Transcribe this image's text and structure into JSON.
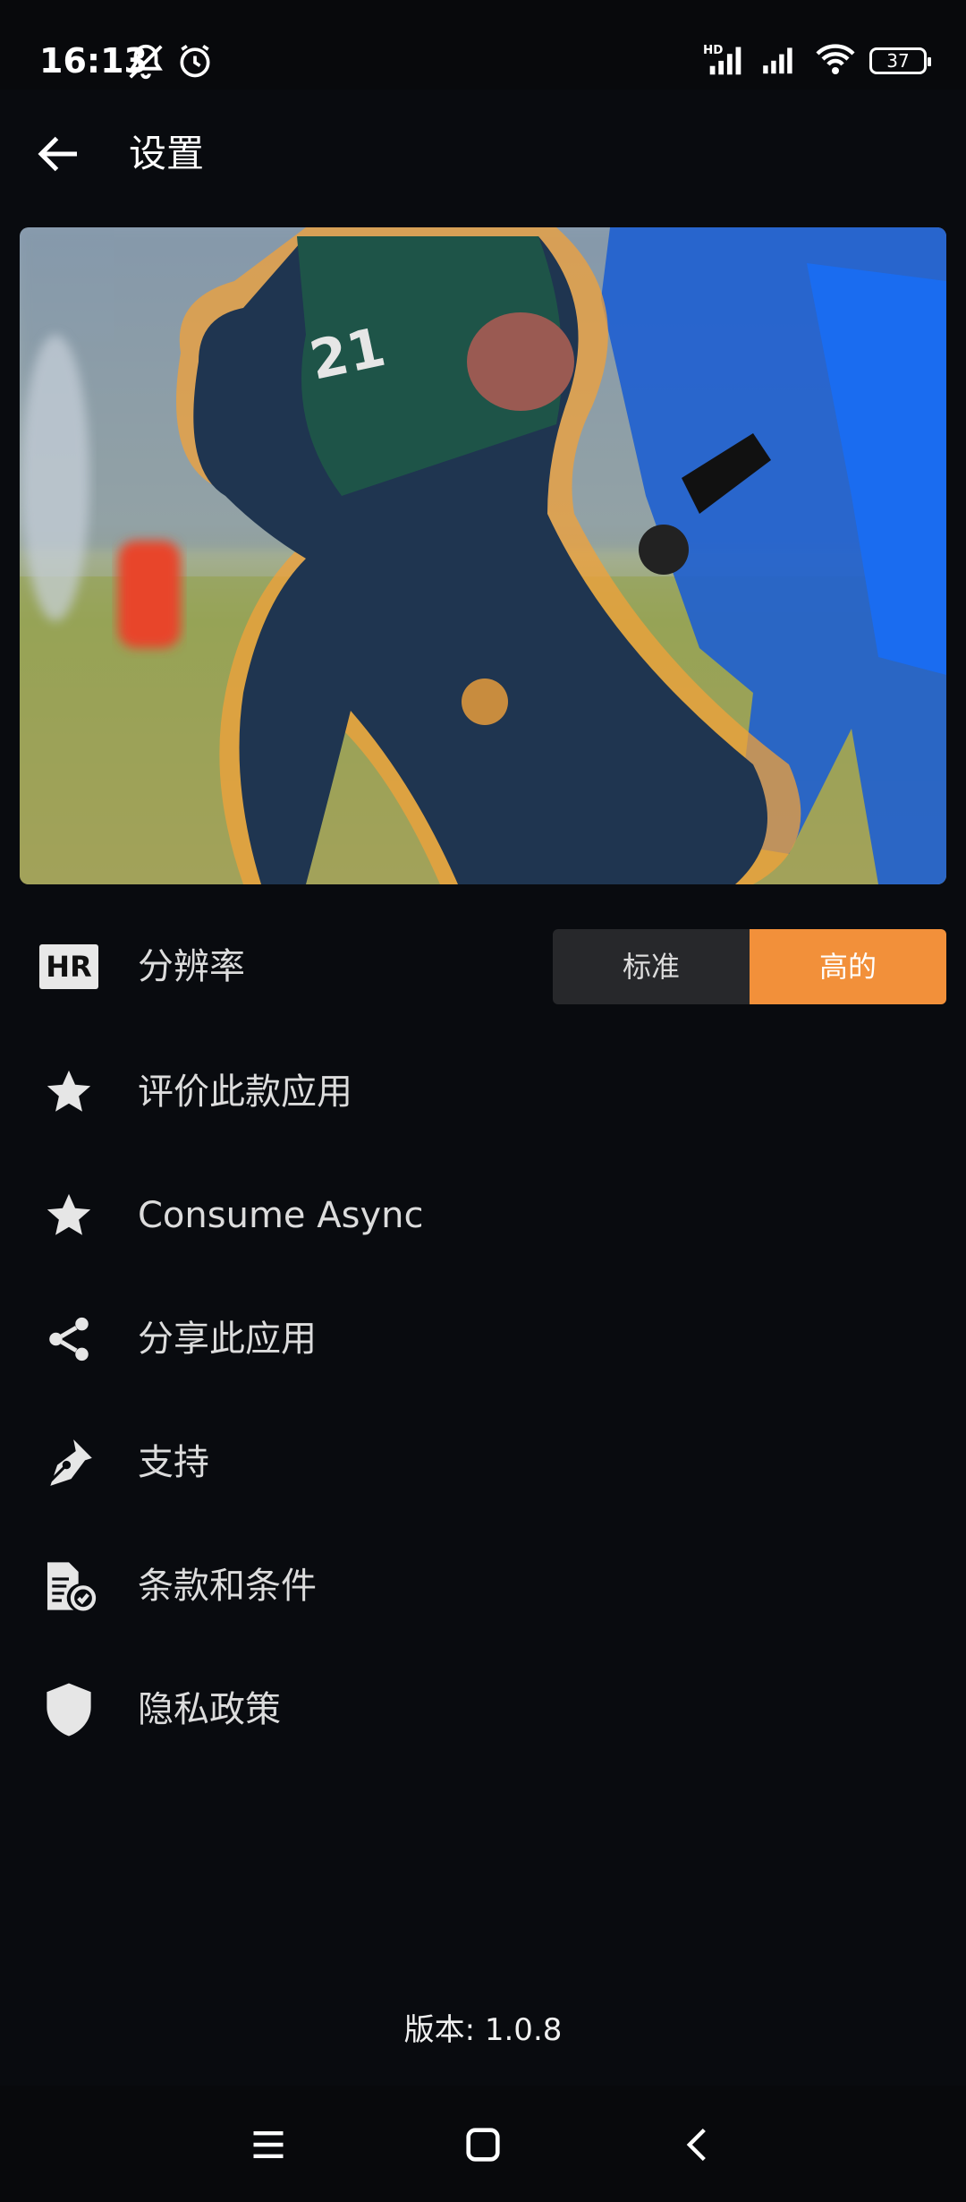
{
  "status_bar": {
    "time": "16:13",
    "icons": [
      "mute-icon",
      "alarm-icon",
      "hd-signal-icon",
      "signal-icon",
      "wifi-icon"
    ],
    "battery": "37"
  },
  "header": {
    "title": "设置"
  },
  "hero_image": {
    "description_icon": "football-photo"
  },
  "settings": {
    "resolution": {
      "icon_text": "HR",
      "label": "分辨率",
      "options": [
        "标准",
        "高的"
      ],
      "selected": "高的"
    },
    "items": [
      {
        "icon": "star-icon",
        "label": "评价此款应用"
      },
      {
        "icon": "star-icon",
        "label": "Consume Async"
      },
      {
        "icon": "share-icon",
        "label": "分享此应用"
      },
      {
        "icon": "pen-icon",
        "label": "支持"
      },
      {
        "icon": "document-check-icon",
        "label": "条款和条件"
      },
      {
        "icon": "shield-icon",
        "label": "隐私政策"
      }
    ]
  },
  "footer": {
    "version": "版本: 1.0.8"
  },
  "colors": {
    "accent": "#f2903a",
    "background": "#090b0f"
  }
}
